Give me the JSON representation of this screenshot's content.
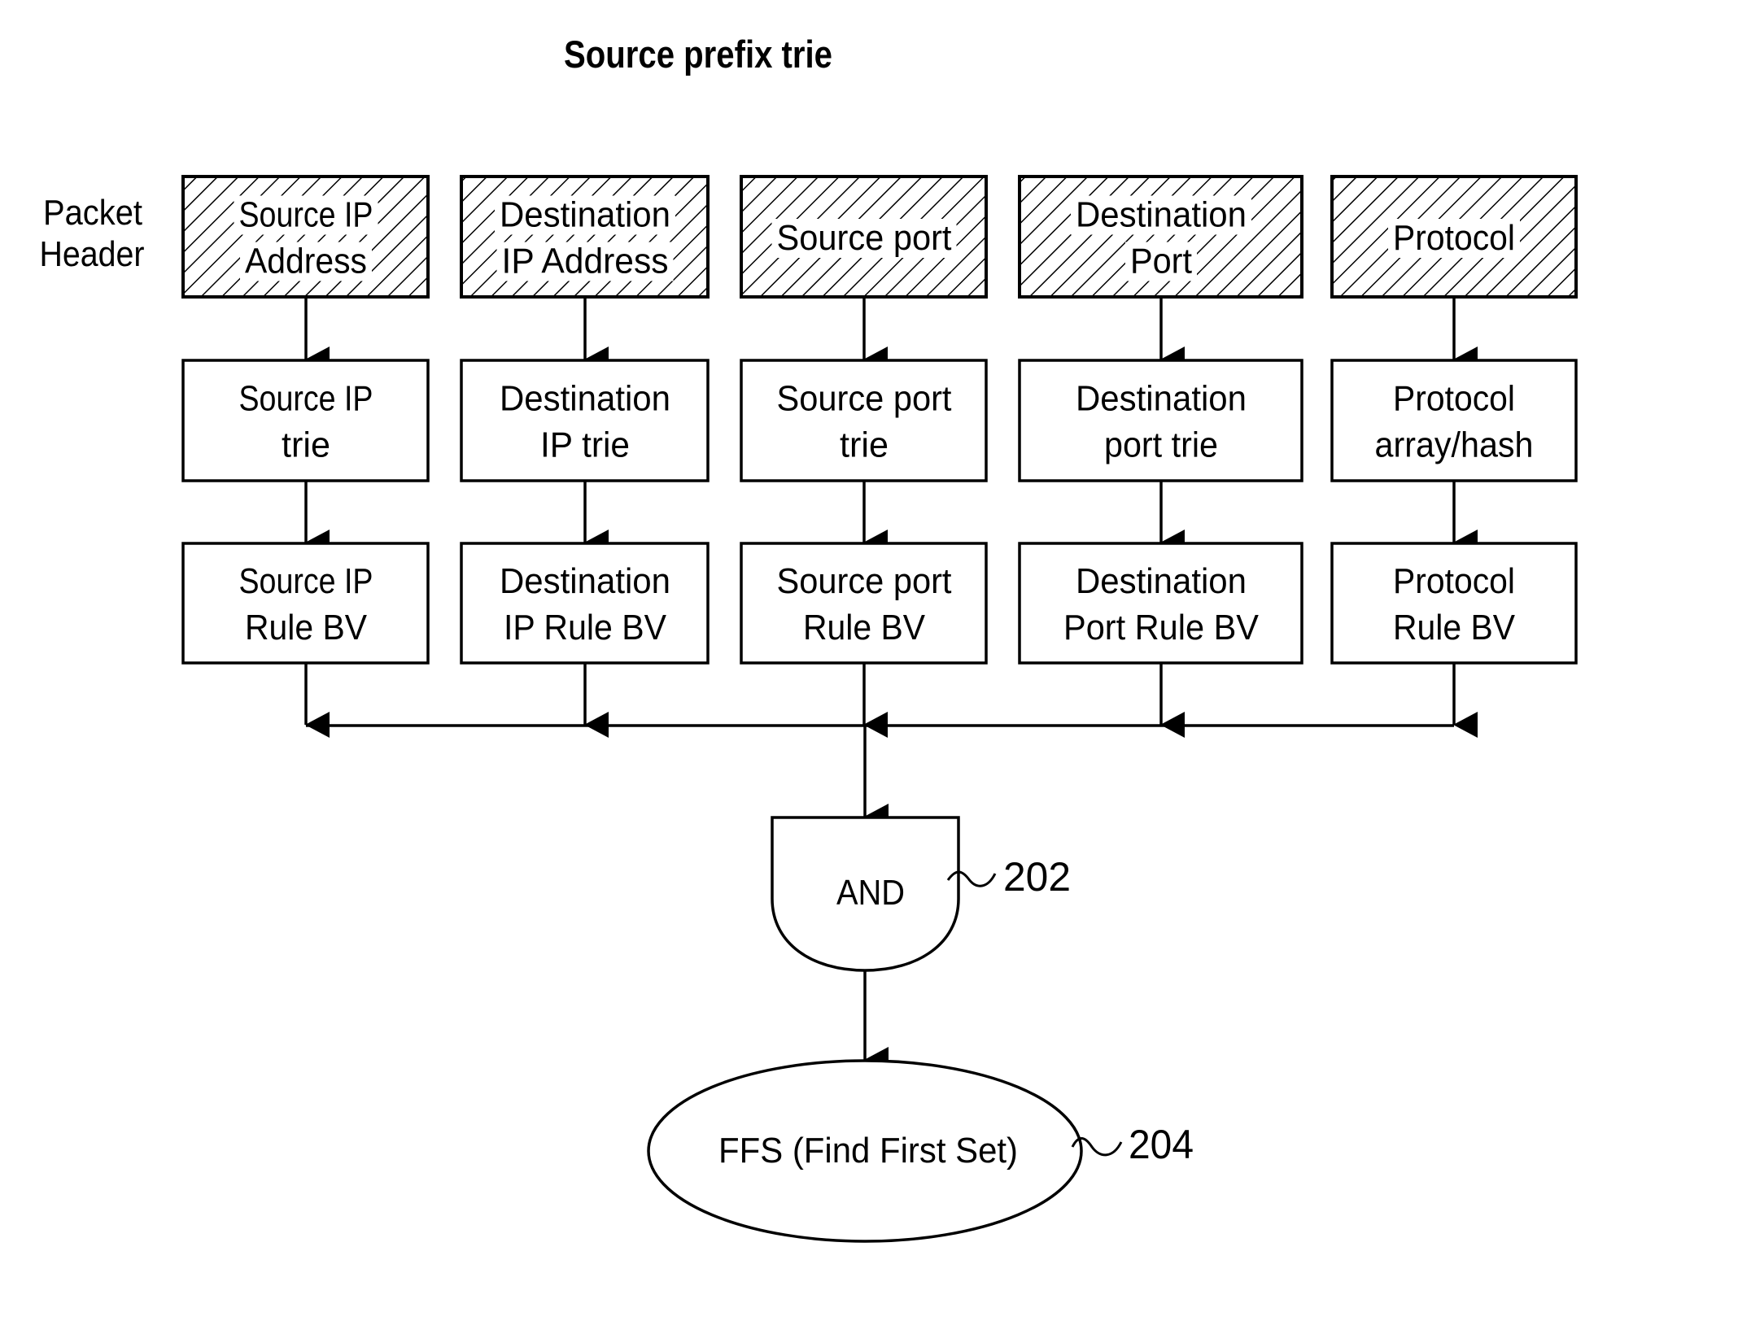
{
  "title": "Source prefix trie",
  "side_label": {
    "lines": [
      "Packet",
      "Header"
    ]
  },
  "columns": [
    {
      "id": "source-ip",
      "header": [
        "Source IP",
        "Address"
      ],
      "lookup": [
        "Source IP",
        "trie"
      ],
      "bitvector": [
        "Source IP",
        "Rule BV"
      ]
    },
    {
      "id": "destination-ip",
      "header": [
        "Destination",
        "IP Address"
      ],
      "lookup": [
        "Destination",
        "IP trie"
      ],
      "bitvector": [
        "Destination",
        "IP Rule BV"
      ]
    },
    {
      "id": "source-port",
      "header": [
        "Source port"
      ],
      "lookup": [
        "Source port",
        "trie"
      ],
      "bitvector": [
        "Source port",
        "Rule BV"
      ]
    },
    {
      "id": "destination-port",
      "header": [
        "Destination",
        "Port"
      ],
      "lookup": [
        "Destination",
        "port trie"
      ],
      "bitvector": [
        "Destination",
        "Port Rule BV"
      ]
    },
    {
      "id": "protocol",
      "header": [
        "Protocol"
      ],
      "lookup": [
        "Protocol",
        "array/hash"
      ],
      "bitvector": [
        "Protocol",
        "Rule BV"
      ]
    }
  ],
  "and_gate": {
    "label": "AND",
    "ref": "202"
  },
  "ffs": {
    "label": "FFS (Find First Set)",
    "ref": "204"
  },
  "colors": {
    "ink": "#000000",
    "background": "#ffffff"
  }
}
